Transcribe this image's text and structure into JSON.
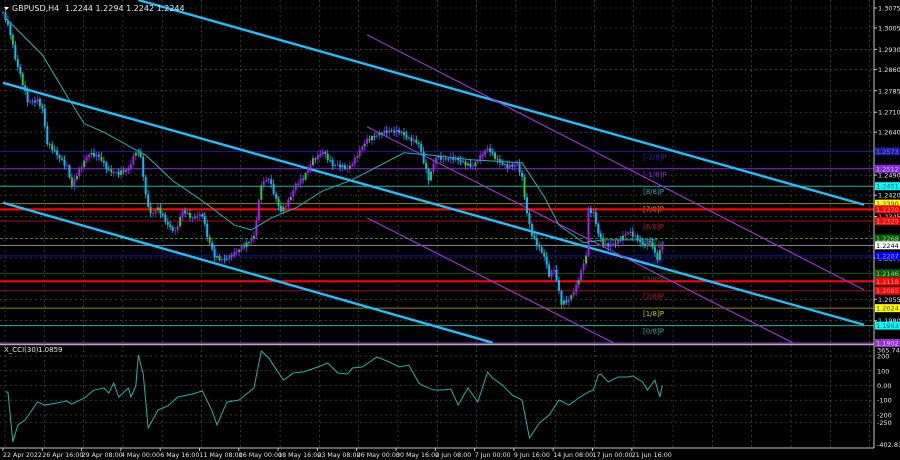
{
  "header": {
    "symbol_title": "GBPUSD,H4",
    "ohlc": "1.2244 1.2294 1.2242 1.2244"
  },
  "indicator": {
    "title": "X_CCI(30)",
    "value": "1.0859"
  },
  "colors": {
    "background": "#000000",
    "grid": "#5a5a5a",
    "axis": "#c8c8c8",
    "bull": "#a020f0",
    "bull_alt": "#32cd32",
    "bear": "#00bfff",
    "ma": "#20b2aa",
    "cci": "#20b2aa",
    "channel": "#1ec0ff",
    "channel_inner": "#9932cc"
  },
  "chart_data": [
    {
      "type": "candlestick",
      "title": "GBPUSD,H4",
      "x_unit": "bar index (H4)",
      "xlim": [
        0,
        350
      ],
      "ylim": [
        1.1902,
        1.3075
      ],
      "grid": true,
      "x_tick_labels": [
        "22 Apr 2022",
        "26 Apr 16:00",
        "29 Apr 08:00",
        "4 May 00:00",
        "6 May 16:00",
        "11 May 08:00",
        "16 May 00:00",
        "18 May 16:00",
        "23 May 08:00",
        "26 May 00:00",
        "30 May 16:00",
        "2 Jun 08:00",
        "7 Jun 00:00",
        "9 Jun 16:00",
        "14 Jun 08:00",
        "17 Jun 00:00",
        "21 Jun 16:00"
      ],
      "y_tick_labels": [
        "1.3075",
        "1.3005",
        "1.2930",
        "1.2860",
        "1.2785",
        "1.2710",
        "1.2640",
        "1.2490",
        "1.2420",
        "1.2345",
        "1.2200",
        "1.2055",
        "1.1980"
      ],
      "close_path": [
        [
          0,
          1.306
        ],
        [
          1,
          1.3033
        ],
        [
          3,
          1.2981
        ],
        [
          5,
          1.2893
        ],
        [
          7,
          1.284
        ],
        [
          10,
          1.2753
        ],
        [
          14,
          1.2753
        ],
        [
          16,
          1.2718
        ],
        [
          18,
          1.2596
        ],
        [
          22,
          1.256
        ],
        [
          26,
          1.2525
        ],
        [
          28,
          1.2456
        ],
        [
          30,
          1.2491
        ],
        [
          35,
          1.256
        ],
        [
          39,
          1.256
        ],
        [
          43,
          1.2508
        ],
        [
          47,
          1.2491
        ],
        [
          51,
          1.2508
        ],
        [
          54,
          1.2578
        ],
        [
          56,
          1.256
        ],
        [
          58,
          1.2421
        ],
        [
          60,
          1.235
        ],
        [
          63,
          1.2368
        ],
        [
          67,
          1.2315
        ],
        [
          70,
          1.2298
        ],
        [
          73,
          1.2368
        ],
        [
          77,
          1.2333
        ],
        [
          81,
          1.235
        ],
        [
          83,
          1.228
        ],
        [
          86,
          1.2211
        ],
        [
          89,
          1.2193
        ],
        [
          91,
          1.2193
        ],
        [
          94,
          1.2211
        ],
        [
          98,
          1.2246
        ],
        [
          102,
          1.228
        ],
        [
          105,
          1.2456
        ],
        [
          108,
          1.2473
        ],
        [
          111,
          1.2403
        ],
        [
          113,
          1.2368
        ],
        [
          116,
          1.2403
        ],
        [
          119,
          1.2456
        ],
        [
          122,
          1.2473
        ],
        [
          126,
          1.2543
        ],
        [
          130,
          1.2578
        ],
        [
          134,
          1.2525
        ],
        [
          140,
          1.2508
        ],
        [
          143,
          1.255
        ],
        [
          146,
          1.2596
        ],
        [
          148,
          1.2613
        ],
        [
          152,
          1.2624
        ],
        [
          157,
          1.2648
        ],
        [
          161,
          1.2648
        ],
        [
          165,
          1.2613
        ],
        [
          169,
          1.2596
        ],
        [
          173,
          1.248
        ],
        [
          176,
          1.256
        ],
        [
          179,
          1.2543
        ],
        [
          185,
          1.2543
        ],
        [
          191,
          1.2525
        ],
        [
          197,
          1.2578
        ],
        [
          201,
          1.2543
        ],
        [
          205,
          1.2525
        ],
        [
          209,
          1.2525
        ],
        [
          211,
          1.2473
        ],
        [
          213,
          1.235
        ],
        [
          215,
          1.228
        ],
        [
          220,
          1.2211
        ],
        [
          222,
          1.2141
        ],
        [
          224,
          1.2158
        ],
        [
          227,
          1.2036
        ],
        [
          230,
          1.2053
        ],
        [
          233,
          1.2106
        ],
        [
          235,
          1.2158
        ],
        [
          237,
          1.2211
        ],
        [
          238,
          1.2368
        ],
        [
          240,
          1.235
        ],
        [
          242,
          1.228
        ],
        [
          244,
          1.2246
        ],
        [
          246,
          1.2246
        ],
        [
          250,
          1.2263
        ],
        [
          254,
          1.2288
        ],
        [
          258,
          1.2263
        ],
        [
          260,
          1.2246
        ],
        [
          263,
          1.2263
        ],
        [
          266,
          1.22
        ],
        [
          268,
          1.2244
        ]
      ],
      "moving_average": [
        [
          1,
          1.304
        ],
        [
          16,
          1.2911
        ],
        [
          27,
          1.2753
        ],
        [
          33,
          1.267
        ],
        [
          41,
          1.264
        ],
        [
          54,
          1.2578
        ],
        [
          58,
          1.256
        ],
        [
          69,
          1.247
        ],
        [
          81,
          1.24
        ],
        [
          94,
          1.2315
        ],
        [
          101,
          1.2298
        ],
        [
          109,
          1.234
        ],
        [
          119,
          1.2375
        ],
        [
          130,
          1.2435
        ],
        [
          141,
          1.247
        ],
        [
          149,
          1.2505
        ],
        [
          163,
          1.2568
        ],
        [
          174,
          1.256
        ],
        [
          191,
          1.2543
        ],
        [
          211,
          1.2533
        ],
        [
          220,
          1.2414
        ],
        [
          226,
          1.2315
        ],
        [
          236,
          1.2253
        ],
        [
          244,
          1.2263
        ],
        [
          266,
          1.2263
        ]
      ],
      "current_price": 1.2244,
      "trendlines": [
        {
          "name": "channel-upper",
          "kind": "channel",
          "from": [
            55,
            1.3103
          ],
          "to": [
            350,
            1.2386
          ]
        },
        {
          "name": "channel-middle",
          "kind": "channel",
          "from": [
            0,
            1.2813
          ],
          "to": [
            350,
            1.1966
          ]
        },
        {
          "name": "channel-lower",
          "kind": "channel",
          "from": [
            0,
            1.2393
          ],
          "to": [
            199,
            1.1903
          ]
        },
        {
          "name": "inner-channel-upper",
          "kind": "channel_inner",
          "from": [
            148,
            1.2981
          ],
          "to": [
            350,
            1.2088
          ]
        },
        {
          "name": "inner-channel-middle",
          "kind": "channel_inner",
          "from": [
            148,
            1.2659
          ],
          "to": [
            321,
            1.1903
          ]
        },
        {
          "name": "inner-channel-lower",
          "kind": "channel_inner",
          "from": [
            148,
            1.234
          ],
          "to": [
            248,
            1.1903
          ]
        }
      ],
      "levels": [
        {
          "price": 1.2573,
          "tag": "1.2573",
          "label": "[-2/8]P",
          "line": "#1c1c9c",
          "tag_bg": "#1c1c9c",
          "tag_fg": "#6f6fff",
          "label_color": "#2a2acc"
        },
        {
          "price": 1.2512,
          "tag": "1.2512",
          "label": "[-1/8]P",
          "line": "#8a2be2",
          "tag_bg": "#8a2be2",
          "tag_fg": "#e0c0ff",
          "label_color": "#8a2be2"
        },
        {
          "price": 1.2451,
          "tag": "1.2451",
          "label": "[8/8]P",
          "line": "#20b2aa",
          "tag_bg": "#00ffff",
          "tag_fg": "#004050",
          "label_color": "#20b2aa"
        },
        {
          "price": 1.239,
          "tag": "1.2390",
          "label": "[7/8]P",
          "line": "#8b8b00",
          "tag_bg": "#ffff00",
          "tag_fg": "#404000",
          "label_color": "#c8c800"
        },
        {
          "price": 1.237,
          "tag": "1.2370",
          "label": "",
          "line": "#ff0000",
          "thick": true,
          "tag_bg": "#ff0000",
          "tag_fg": "#ffb0b0"
        },
        {
          "price": 1.2329,
          "tag": "1.2329",
          "label": "[6/8]P",
          "line": "#a01010",
          "tag_bg": "#ff0000",
          "tag_fg": "#ffb0b0",
          "label_color": "#c01818"
        },
        {
          "price": 1.2268,
          "tag": "1.2268",
          "label": "[5/8]P",
          "line": "#2e8b2e",
          "dashed": true,
          "tag_bg": "#0b5f0b",
          "tag_fg": "#90d090",
          "label_color": "#2e8b2e"
        },
        {
          "price": 1.2244,
          "tag": "1.2244",
          "label": "",
          "line": "#8c8c8c",
          "tag_bg": "#ffffff",
          "tag_fg": "#000000"
        },
        {
          "price": 1.2207,
          "tag": "1.2207",
          "label": "[4/8]P",
          "line": "#1010c0",
          "tag_bg": "#0000ff",
          "tag_fg": "#b0b0ff",
          "label_color": "#1a1ad0"
        },
        {
          "price": 1.2146,
          "tag": "1.2146",
          "label": "[3/8]P",
          "line": "#0a5a0a",
          "tag_bg": "#0b5f0b",
          "tag_fg": "#90d090",
          "label_color": "#1a6a1a"
        },
        {
          "price": 1.2118,
          "tag": "1.2118",
          "label": "",
          "line": "#ff0000",
          "thick": true,
          "tag_bg": "#ff0000",
          "tag_fg": "#ffb0b0"
        },
        {
          "price": 1.2085,
          "tag": "1.2085",
          "label": "[2/8]P",
          "line": "#a01010",
          "tag_bg": "#ff0000",
          "tag_fg": "#ffb0b0",
          "label_color": "#c01818"
        },
        {
          "price": 1.2024,
          "tag": "1.2024",
          "label": "[1/8]P",
          "line": "#8b8b00",
          "tag_bg": "#ffff00",
          "tag_fg": "#404000",
          "label_color": "#c8c800"
        },
        {
          "price": 1.1963,
          "tag": "1.1963",
          "label": "[0/8]P",
          "line": "#20b2aa",
          "tag_bg": "#00ffff",
          "tag_fg": "#004050",
          "label_color": "#20b2aa"
        },
        {
          "price": 1.1902,
          "tag": "1.1902",
          "label": "",
          "line": "#9932cc",
          "tag_bg": "#9932cc",
          "tag_fg": "#e0c0ff"
        }
      ]
    },
    {
      "type": "line",
      "title": "X_CCI(30)",
      "ylim": [
        -402.81,
        365.7453
      ],
      "y_tick_labels": [
        "365.7453",
        "200",
        "100",
        "0.00",
        "-100",
        "-200",
        "-250",
        "-402.810"
      ],
      "y_tick_values": [
        365.7453,
        200,
        100,
        0,
        -100,
        -200,
        -250,
        -402.81
      ],
      "points": [
        [
          1,
          -44
        ],
        [
          2,
          -44
        ],
        [
          4,
          -384
        ],
        [
          6,
          -269
        ],
        [
          9,
          -235
        ],
        [
          14,
          -112
        ],
        [
          17,
          -133
        ],
        [
          22,
          -119
        ],
        [
          26,
          -105
        ],
        [
          28,
          -126
        ],
        [
          33,
          -85
        ],
        [
          37,
          -31
        ],
        [
          41,
          -17
        ],
        [
          43,
          -51
        ],
        [
          45,
          17
        ],
        [
          47,
          -78
        ],
        [
          51,
          -17
        ],
        [
          52,
          -78
        ],
        [
          54,
          -3
        ],
        [
          55,
          207
        ],
        [
          57,
          78
        ],
        [
          59,
          -289
        ],
        [
          63,
          -167
        ],
        [
          67,
          -139
        ],
        [
          71,
          -78
        ],
        [
          77,
          -58
        ],
        [
          81,
          -37
        ],
        [
          85,
          -173
        ],
        [
          87,
          -269
        ],
        [
          91,
          -112
        ],
        [
          96,
          -99
        ],
        [
          102,
          -17
        ],
        [
          105,
          235
        ],
        [
          108,
          187
        ],
        [
          114,
          37
        ],
        [
          118,
          85
        ],
        [
          122,
          92
        ],
        [
          128,
          126
        ],
        [
          132,
          153
        ],
        [
          136,
          85
        ],
        [
          140,
          78
        ],
        [
          142,
          119
        ],
        [
          146,
          126
        ],
        [
          152,
          194
        ],
        [
          157,
          160
        ],
        [
          161,
          126
        ],
        [
          165,
          139
        ],
        [
          169,
          17
        ],
        [
          171,
          -3
        ],
        [
          175,
          -31
        ],
        [
          179,
          -31
        ],
        [
          182,
          -24
        ],
        [
          185,
          -133
        ],
        [
          189,
          -17
        ],
        [
          193,
          -112
        ],
        [
          197,
          92
        ],
        [
          199,
          51
        ],
        [
          203,
          3
        ],
        [
          207,
          -65
        ],
        [
          211,
          -99
        ],
        [
          214,
          -357
        ],
        [
          218,
          -255
        ],
        [
          222,
          -201
        ],
        [
          226,
          -99
        ],
        [
          230,
          -133
        ],
        [
          234,
          -85
        ],
        [
          238,
          -44
        ],
        [
          240,
          -31
        ],
        [
          242,
          71
        ],
        [
          243,
          78
        ],
        [
          246,
          24
        ],
        [
          250,
          58
        ],
        [
          254,
          58
        ],
        [
          256,
          65
        ],
        [
          260,
          24
        ],
        [
          262,
          -31
        ],
        [
          265,
          37
        ],
        [
          267,
          -78
        ],
        [
          268,
          1.0859
        ]
      ]
    }
  ]
}
